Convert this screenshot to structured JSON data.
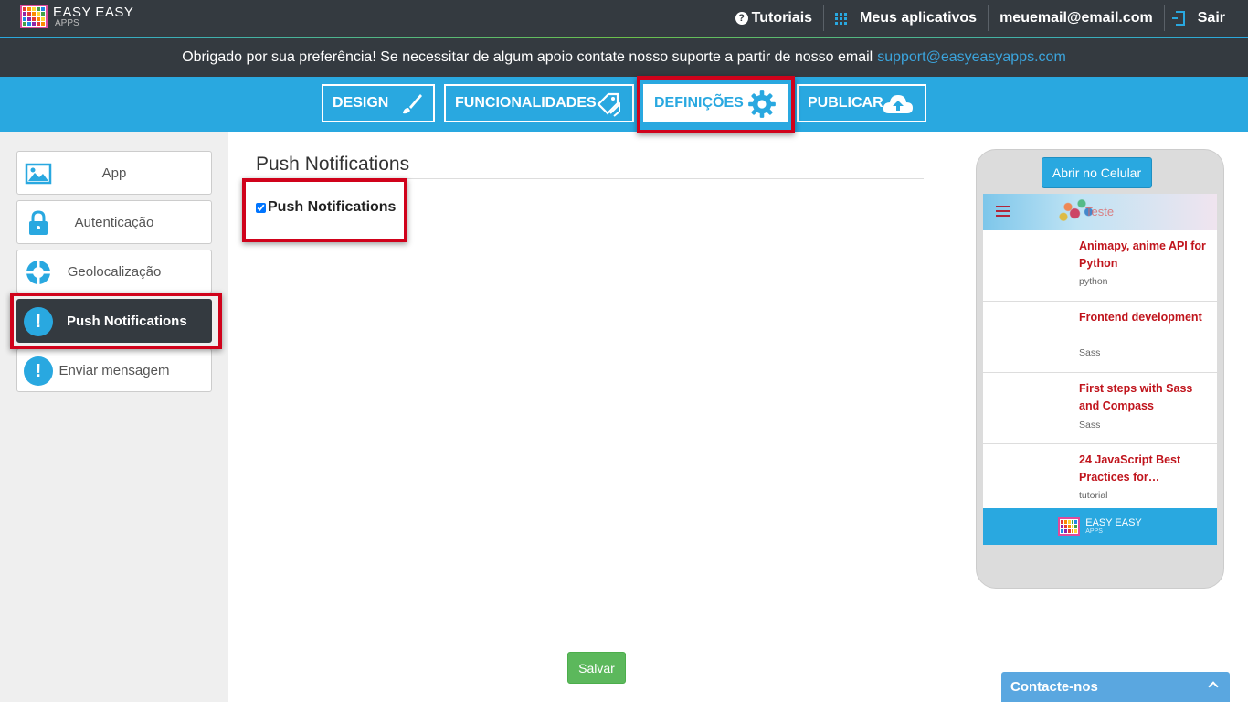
{
  "brand": {
    "name": "EASY EASY",
    "sub": "APPS"
  },
  "top_nav": {
    "tutorials": "Tutoriais",
    "my_apps": "Meus aplicativos",
    "email": "meuemail@email.com",
    "logout": "Sair"
  },
  "notice": {
    "text": "Obrigado por sua preferência! Se necessitar de algum apoio contate nosso suporte a partir de nosso email",
    "email": "support@easyeasyapps.com"
  },
  "tabs": [
    {
      "label": "DESIGN",
      "icon": "brush-icon"
    },
    {
      "label": "FUNCIONALIDADES",
      "icon": "tags-icon"
    },
    {
      "label": "DEFINIÇÕES",
      "icon": "gear-icon",
      "active": true
    },
    {
      "label": "PUBLICAR",
      "icon": "cloud-upload-icon"
    }
  ],
  "sidebar": {
    "items": [
      {
        "label": "App",
        "icon": "image-icon"
      },
      {
        "label": "Autenticação",
        "icon": "lock-icon"
      },
      {
        "label": "Geolocalização",
        "icon": "crosshair-icon"
      },
      {
        "label": "Push Notifications",
        "icon": "alert-bubble-icon",
        "active": true
      },
      {
        "label": "Enviar mensagem",
        "icon": "alert-bubble-icon"
      }
    ]
  },
  "main": {
    "title": "Push Notifications",
    "checkbox_label": "Push Notifications",
    "checkbox_checked": true,
    "save_label": "Salvar"
  },
  "preview": {
    "open_button": "Abrir no Celular",
    "app_title": "Teste",
    "posts": [
      {
        "title": "Animapy, anime API for Python",
        "tag": "python"
      },
      {
        "title": "Frontend development",
        "tag": "Sass"
      },
      {
        "title": "First steps with Sass and Compass",
        "tag": "Sass"
      },
      {
        "title": "24 JavaScript Best Practices for…",
        "tag": "tutorial"
      }
    ],
    "footer_brand": "EASY EASY",
    "footer_sub": "APPS"
  },
  "contact": {
    "label": "Contacte-nos"
  },
  "colors": {
    "accent": "#29a8e0",
    "dark": "#343a40",
    "highlight": "#d0021b",
    "save": "#5cb85c",
    "post_title": "#c0141c"
  }
}
